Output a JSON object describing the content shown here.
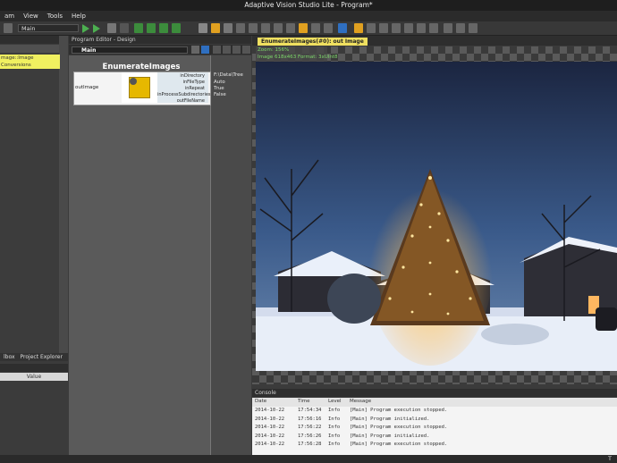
{
  "window": {
    "title": "Adaptive Vision Studio Lite - Program*"
  },
  "menu": [
    {
      "label": "am"
    },
    {
      "label": "View"
    },
    {
      "label": "Tools"
    },
    {
      "label": "Help"
    }
  ],
  "toolbar": {
    "program_combo": "Main"
  },
  "left_panel": {
    "highlight_text": "mage::Image Conversions",
    "bottom_tabs": {
      "toolbox": "lbox",
      "project_explorer": "Project Explorer"
    },
    "properties_value_header": "Value"
  },
  "program_editor": {
    "header": "Program Editor - Design",
    "breadcrumb": "Main",
    "node": {
      "title": "EnumerateImages",
      "output_port": "outImage",
      "ports": [
        {
          "name": "inDirectory",
          "value": "F:\\Data\\Tree"
        },
        {
          "name": "inFileType",
          "value": "Auto"
        },
        {
          "name": "inRepeat",
          "value": "True"
        },
        {
          "name": "inProcessSubdirectories",
          "value": "False"
        },
        {
          "name": "outFileName",
          "value": ""
        }
      ]
    }
  },
  "image_view": {
    "tab_label": "EnumerateImages(#0): out Image",
    "zoom_text": "Zoom: 156%",
    "image_info": "Image 618x463 Format: 3xUInt8"
  },
  "console": {
    "header": "Console",
    "columns": [
      "Date",
      "Time",
      "Level",
      "Message"
    ],
    "rows": [
      [
        "2014-10-22",
        "17:54:34",
        "Info",
        "[Main] Program execution stopped."
      ],
      [
        "2014-10-22",
        "17:56:16",
        "Info",
        "[Main] Program initialized."
      ],
      [
        "2014-10-22",
        "17:56:22",
        "Info",
        "[Main] Program execution stopped."
      ],
      [
        "2014-10-22",
        "17:56:26",
        "Info",
        "[Main] Program initialized."
      ],
      [
        "2014-10-22",
        "17:56:28",
        "Info",
        "[Main] Program execution stopped."
      ]
    ]
  },
  "statusbar": {
    "right": "T"
  }
}
